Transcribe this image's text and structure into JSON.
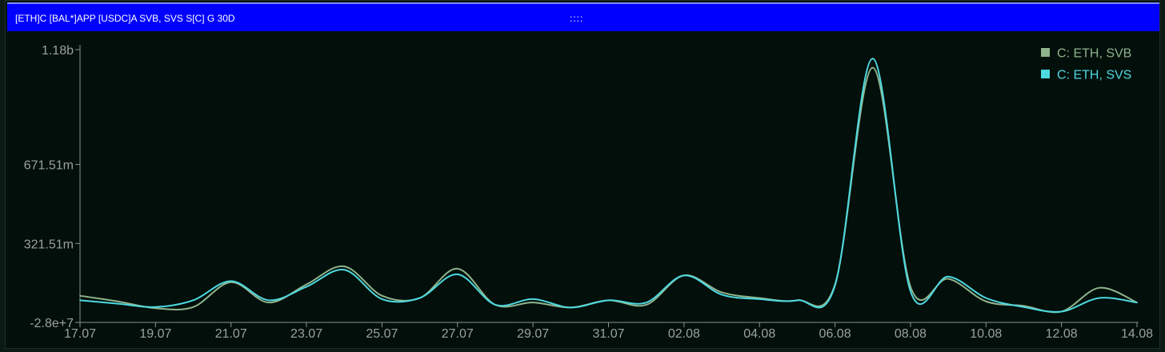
{
  "window": {
    "title": "[ETH]C [BAL*]APP [USDC]A SVB, SVS S[C] G 30D",
    "drag_handle": "::::"
  },
  "chart_data": {
    "type": "line",
    "title": "",
    "xlabel": "",
    "ylabel": "",
    "x": [
      "17.07",
      "18.07",
      "19.07",
      "20.07",
      "21.07",
      "22.07",
      "23.07",
      "24.07",
      "25.07",
      "26.07",
      "27.07",
      "28.07",
      "29.07",
      "30.07",
      "31.07",
      "01.08",
      "02.08",
      "03.08",
      "04.08",
      "05.08",
      "06.08",
      "07.08",
      "08.08",
      "09.08",
      "10.08",
      "11.08",
      "12.08",
      "13.08",
      "14.08"
    ],
    "x_ticks": [
      "17.07",
      "19.07",
      "21.07",
      "23.07",
      "25.07",
      "27.07",
      "29.07",
      "31.07",
      "02.08",
      "04.08",
      "06.08",
      "08.08",
      "10.08",
      "12.08",
      "14.08"
    ],
    "y_ticks": [
      {
        "value": -28000000,
        "label": "-2.8e+7"
      },
      {
        "value": 321510000,
        "label": "321.51m"
      },
      {
        "value": 671510000,
        "label": "671.51m"
      },
      {
        "value": 1180000000,
        "label": "1.18b"
      }
    ],
    "ylim": [
      -28000000,
      1180000000
    ],
    "series": [
      {
        "name": "C: ETH, SVB",
        "color": "#8fb48c",
        "values": [
          90000000,
          65000000,
          35000000,
          40000000,
          150000000,
          60000000,
          140000000,
          220000000,
          90000000,
          80000000,
          210000000,
          50000000,
          60000000,
          38000000,
          70000000,
          50000000,
          180000000,
          105000000,
          80000000,
          70000000,
          140000000,
          1100000000,
          130000000,
          165000000,
          65000000,
          45000000,
          20000000,
          125000000,
          60000000
        ]
      },
      {
        "name": "C: ETH, SVS",
        "color": "#4ed8e0",
        "values": [
          70000000,
          55000000,
          40000000,
          70000000,
          155000000,
          70000000,
          130000000,
          205000000,
          75000000,
          80000000,
          185000000,
          50000000,
          75000000,
          38000000,
          70000000,
          60000000,
          180000000,
          95000000,
          75000000,
          70000000,
          135000000,
          1140000000,
          110000000,
          175000000,
          80000000,
          40000000,
          20000000,
          80000000,
          60000000
        ]
      }
    ],
    "legend": "top-right",
    "grid": false
  }
}
